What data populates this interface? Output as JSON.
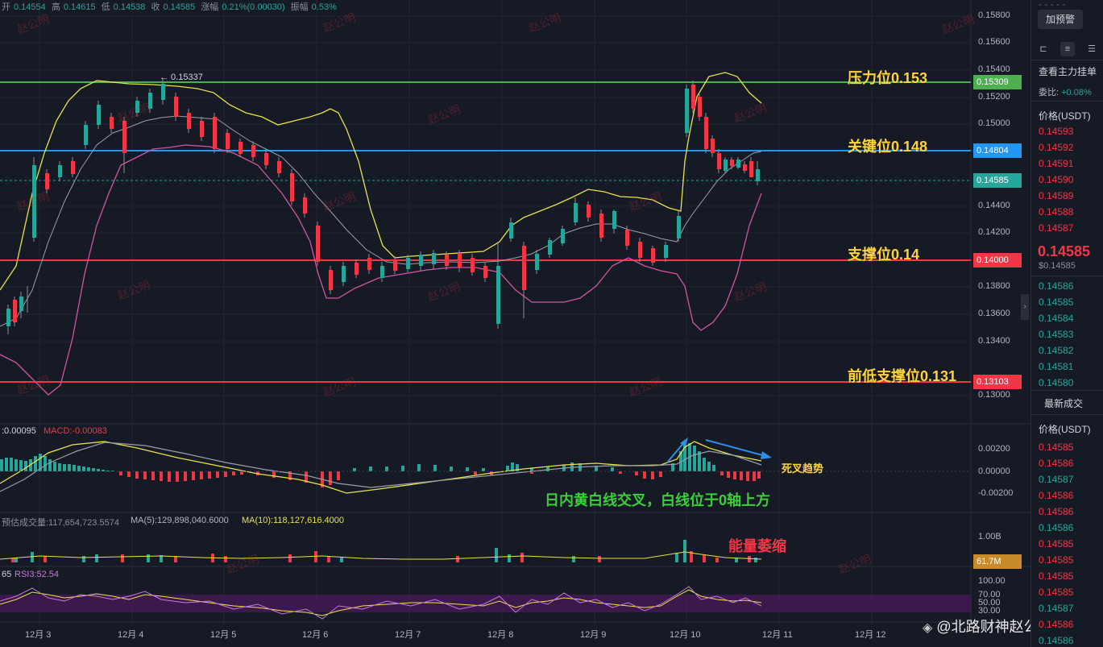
{
  "ohlc": {
    "open_label": "开",
    "open": "0.14554",
    "high_label": "高",
    "high": "0.14615",
    "low_label": "低",
    "low": "0.14538",
    "close_label": "收",
    "close": "0.14585",
    "change_label": "涨幅",
    "change": "0.21%(0.00030)",
    "amp_label": "振幅",
    "amp": "0.53%"
  },
  "price_axis": [
    "0.15800",
    "0.15600",
    "0.15400",
    "0.15200",
    "0.15000",
    "0.14400",
    "0.14200",
    "0.13800",
    "0.13600",
    "0.13400",
    "0.13000"
  ],
  "price_tags": [
    {
      "value": "0.15309",
      "color": "#4caf50"
    },
    {
      "value": "0.14804",
      "color": "#2196f3"
    },
    {
      "value": "0.14585",
      "color": "#26a69a"
    },
    {
      "value": "0.14000",
      "color": "#f23645"
    },
    {
      "value": "0.13103",
      "color": "#f23645"
    }
  ],
  "high_marker": "← 0.15337",
  "annotations": {
    "resistance": "压力位0.153",
    "key_level": "关键位0.148",
    "support": "支撑位0.14",
    "prev_low_support": "前低支撑位0.131",
    "death_cross": "死叉趋势",
    "macd_note": "日内黄白线交叉，白线位于0轴上方",
    "volume_note": "能量萎缩"
  },
  "macd": {
    "label_dif": ":0.00095",
    "label_macd": "MACD:-0.00083",
    "axis": [
      "0.00200",
      "0.00000",
      "-0.00200"
    ]
  },
  "volume": {
    "label_est": "预估成交量:117,654,723.5574",
    "label_ma5": "MA(5):129,898,040.6000",
    "label_ma10": "MA(10):118,127,616.4000",
    "axis_top": "1.00B",
    "current": "61.7M"
  },
  "rsi": {
    "label_prefix": "65",
    "label_rsi3": "RSI3:52.54",
    "axis": [
      "100.00",
      "70.00",
      "50.00",
      "30.00"
    ]
  },
  "dates": [
    "12月 3",
    "12月 4",
    "12月 5",
    "12月 6",
    "12月 7",
    "12月 8",
    "12月 9",
    "12月 10",
    "12月 11",
    "12月 12"
  ],
  "watermark": "赵公明",
  "brand": "@北路财神赵公明",
  "right_panel": {
    "alert_button": "加预警",
    "depth_title": "查看主力挂单",
    "ratio_label": "委比:",
    "ratio_value": "+0.08%",
    "price_header": "价格(USDT)",
    "asks": [
      "0.14593",
      "0.14592",
      "0.14591",
      "0.14590",
      "0.14589",
      "0.14588",
      "0.14587"
    ],
    "last_price": "0.14585",
    "last_price_usd": "$0.14585",
    "bids": [
      "0.14586",
      "0.14585",
      "0.14584",
      "0.14583",
      "0.14582",
      "0.14581",
      "0.14580"
    ],
    "trades_title": "最新成交",
    "trades_header": "价格(USDT)",
    "trades": [
      {
        "p": "0.14585",
        "c": "red"
      },
      {
        "p": "0.14586",
        "c": "red"
      },
      {
        "p": "0.14587",
        "c": "green"
      },
      {
        "p": "0.14586",
        "c": "red"
      },
      {
        "p": "0.14586",
        "c": "red"
      },
      {
        "p": "0.14586",
        "c": "green"
      },
      {
        "p": "0.14585",
        "c": "red"
      },
      {
        "p": "0.14585",
        "c": "red"
      },
      {
        "p": "0.14585",
        "c": "red"
      },
      {
        "p": "0.14585",
        "c": "red"
      },
      {
        "p": "0.14587",
        "c": "green"
      },
      {
        "p": "0.14586",
        "c": "red"
      },
      {
        "p": "0.14586",
        "c": "green"
      }
    ]
  }
}
